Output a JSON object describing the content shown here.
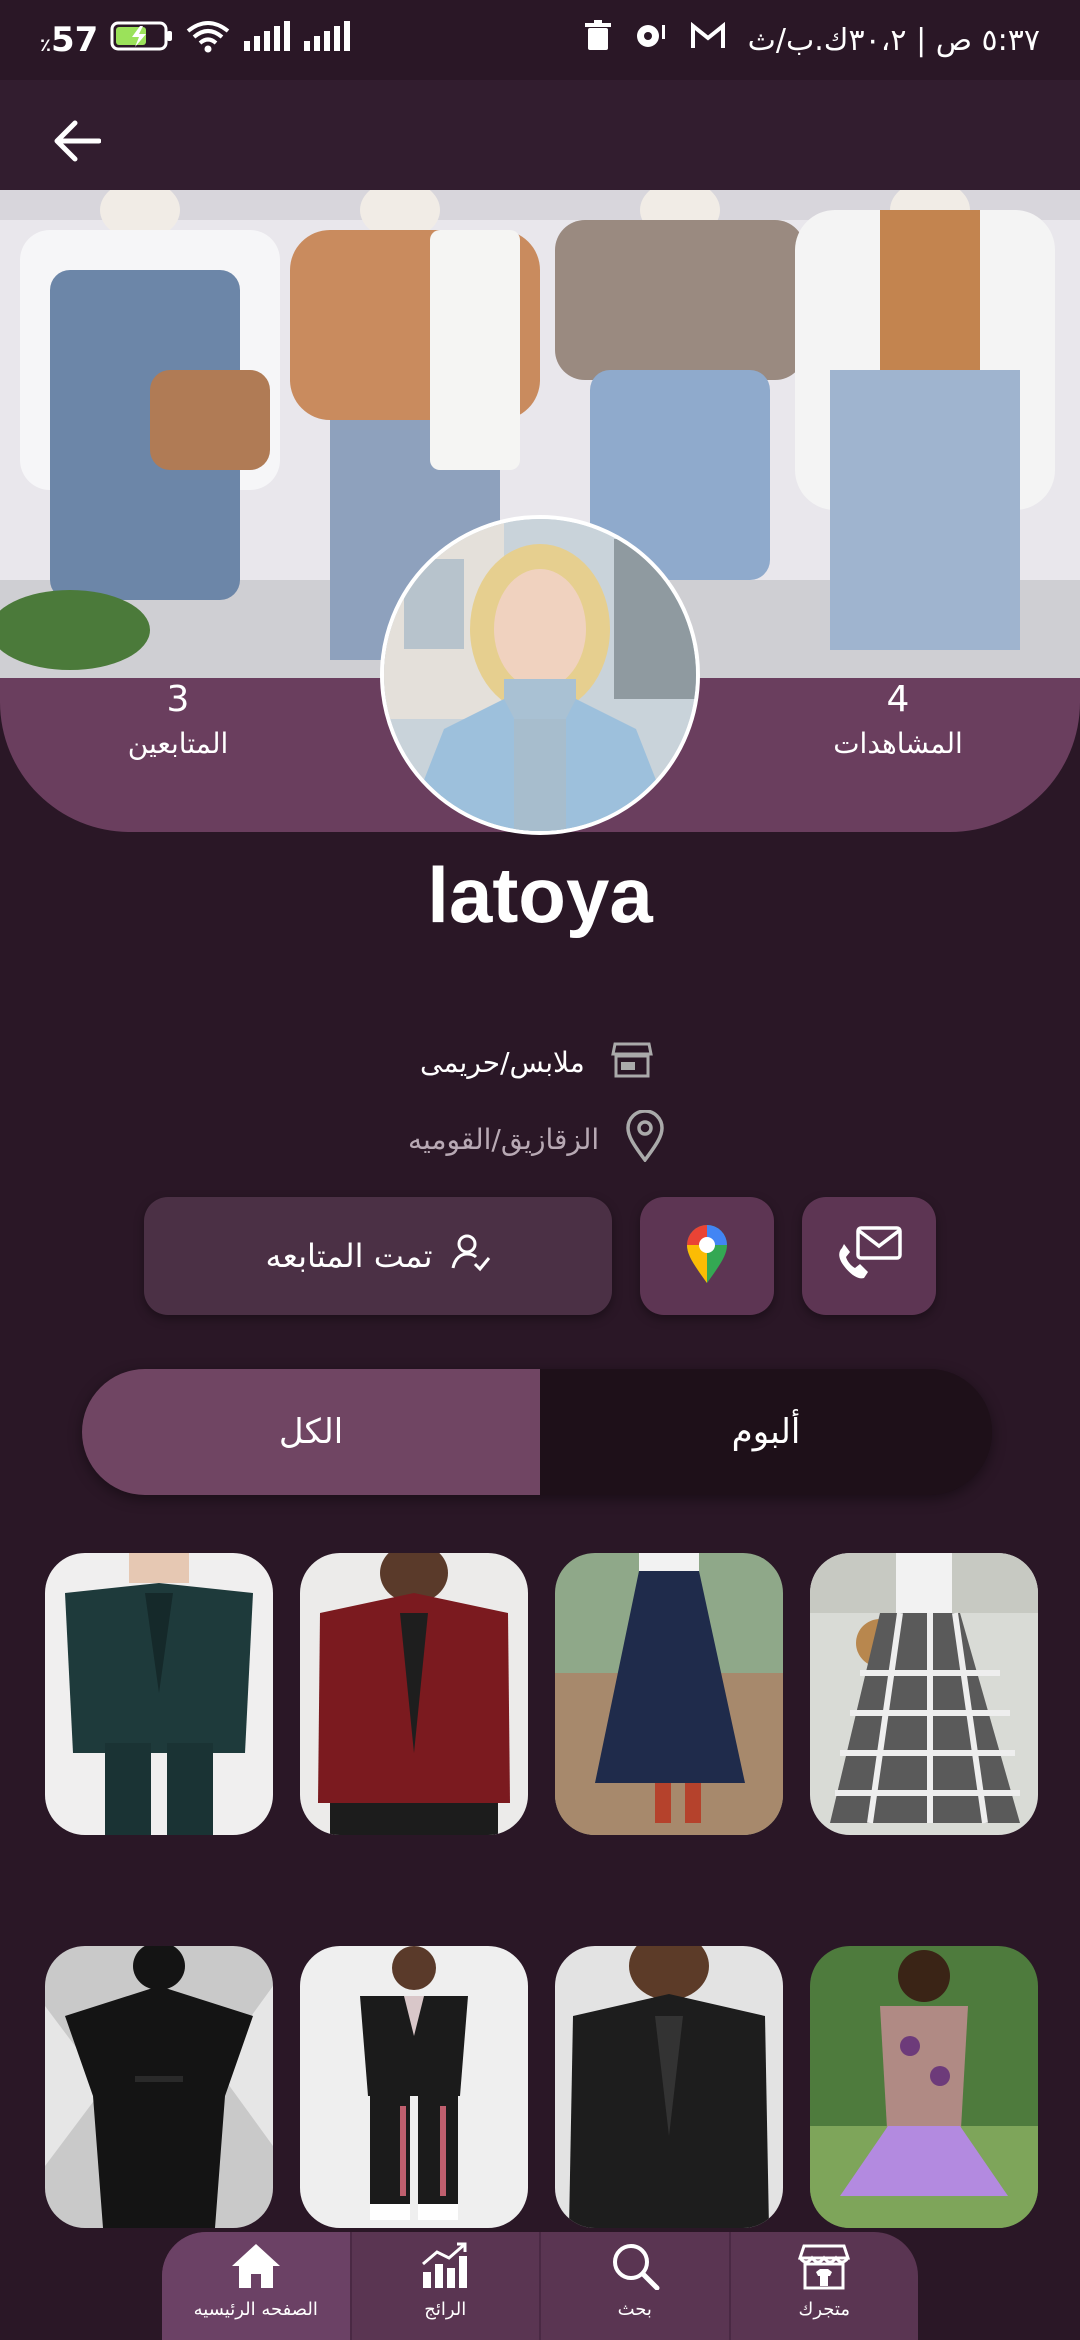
{
  "status_bar": {
    "time": "٥:٣٧ ص | ٣٠،٢ك.ب/ث",
    "battery": "57",
    "battery_suffix": "٪"
  },
  "cover_image": "mannequins-clothing-photo",
  "profile": {
    "avatar": "woman-portrait-photo",
    "username": "latoya",
    "followers_count": "3",
    "followers_label": "المتابعين",
    "views_count": "4",
    "views_label": "المشاهدات",
    "category": "ملابس/حريمى",
    "location": "الزقازيق/القوميه"
  },
  "actions": {
    "follow_label": "تمت المتابعه",
    "maps_icon": "google-maps-icon",
    "contact_icon": "phone-mail-icon"
  },
  "tabs": [
    {
      "label": "الكل",
      "active": true
    },
    {
      "label": "ألبوم",
      "active": false
    }
  ],
  "products": [
    {
      "name": "checkered-maxi-skirt"
    },
    {
      "name": "navy-slit-skirt"
    },
    {
      "name": "burgundy-leather-jacket"
    },
    {
      "name": "green-pantsuit"
    },
    {
      "name": "floral-mermaid-dress"
    },
    {
      "name": "black-leather-jacket"
    },
    {
      "name": "black-track-suit"
    },
    {
      "name": "black-abaya"
    }
  ],
  "bottom_nav": [
    {
      "label": "متجرك",
      "icon": "store-icon"
    },
    {
      "label": "بحث",
      "icon": "search-icon"
    },
    {
      "label": "الرائج",
      "icon": "trending-chart-icon"
    },
    {
      "label": "الصفحه الرئيسيه",
      "icon": "home-icon"
    }
  ],
  "colors": {
    "background": "#2a1726",
    "accent": "#704563",
    "band": "#6a3e5e"
  }
}
